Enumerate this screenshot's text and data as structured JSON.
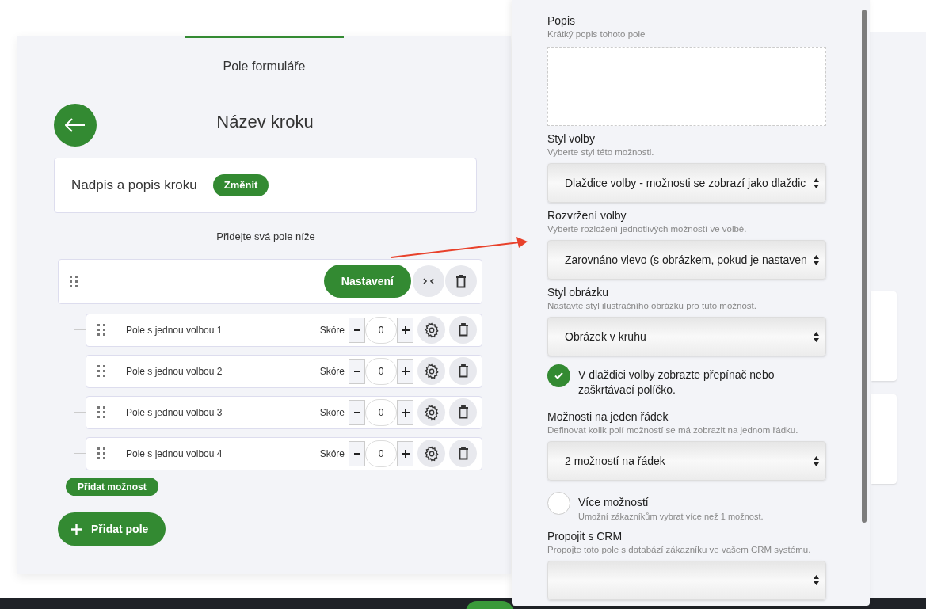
{
  "form_panel": {
    "tabs": [
      {
        "label": "Pole formuláře",
        "selected": true
      }
    ],
    "step_title": "Název kroku",
    "heading_card": {
      "label": "Nadpis a popis kroku",
      "button": "Změnit"
    },
    "hint": "Přidejte svá pole níže",
    "field_group": {
      "settings_button": "Nastavení",
      "options": [
        {
          "label": "Pole s jednou volbou 1",
          "score_label": "Skóre",
          "score": "0"
        },
        {
          "label": "Pole s jednou volbou 2",
          "score_label": "Skóre",
          "score": "0"
        },
        {
          "label": "Pole s jednou volbou 3",
          "score_label": "Skóre",
          "score": "0"
        },
        {
          "label": "Pole s jednou volbou 4",
          "score_label": "Skóre",
          "score": "0"
        }
      ],
      "add_option_button": "Přidat možnost"
    },
    "add_field_button": "Přidat pole"
  },
  "settings_drawer": {
    "sections": [
      {
        "kind": "textarea",
        "label": "Popis",
        "help": "Krátký popis tohoto pole"
      },
      {
        "kind": "select",
        "label": "Styl volby",
        "help": "Vyberte styl této možnosti.",
        "value": "Dlaždice volby - možnosti se zobrazí jako dlaždic"
      },
      {
        "kind": "select",
        "label": "Rozvržení volby",
        "help": "Vyberte rozložení jednotlivých možností ve volbě.",
        "value": "Zarovnáno vlevo (s obrázkem, pokud je nastaven"
      },
      {
        "kind": "select",
        "label": "Styl obrázku",
        "help": "Nastavte styl ilustračního obrázku pro tuto možnost.",
        "value": "Obrázek v kruhu"
      },
      {
        "kind": "checkbox",
        "label": "V dlaždici volby zobrazte přepínač nebo zaškrtávací políčko.",
        "checked": true
      },
      {
        "kind": "select",
        "label": "Možnosti na jeden řádek",
        "help": "Definovat kolik polí možností se má zobrazit na jednom řádku.",
        "value": "2 možností na řádek"
      },
      {
        "kind": "checkbox",
        "label": "Více možností",
        "help": "Umožní zákazníkům vybrat více než 1 možnost.",
        "checked": false
      },
      {
        "kind": "select",
        "label": "Propojit s CRM",
        "help": "Propojte toto pole s databází zákazníku ve vašem CRM systému."
      }
    ]
  }
}
